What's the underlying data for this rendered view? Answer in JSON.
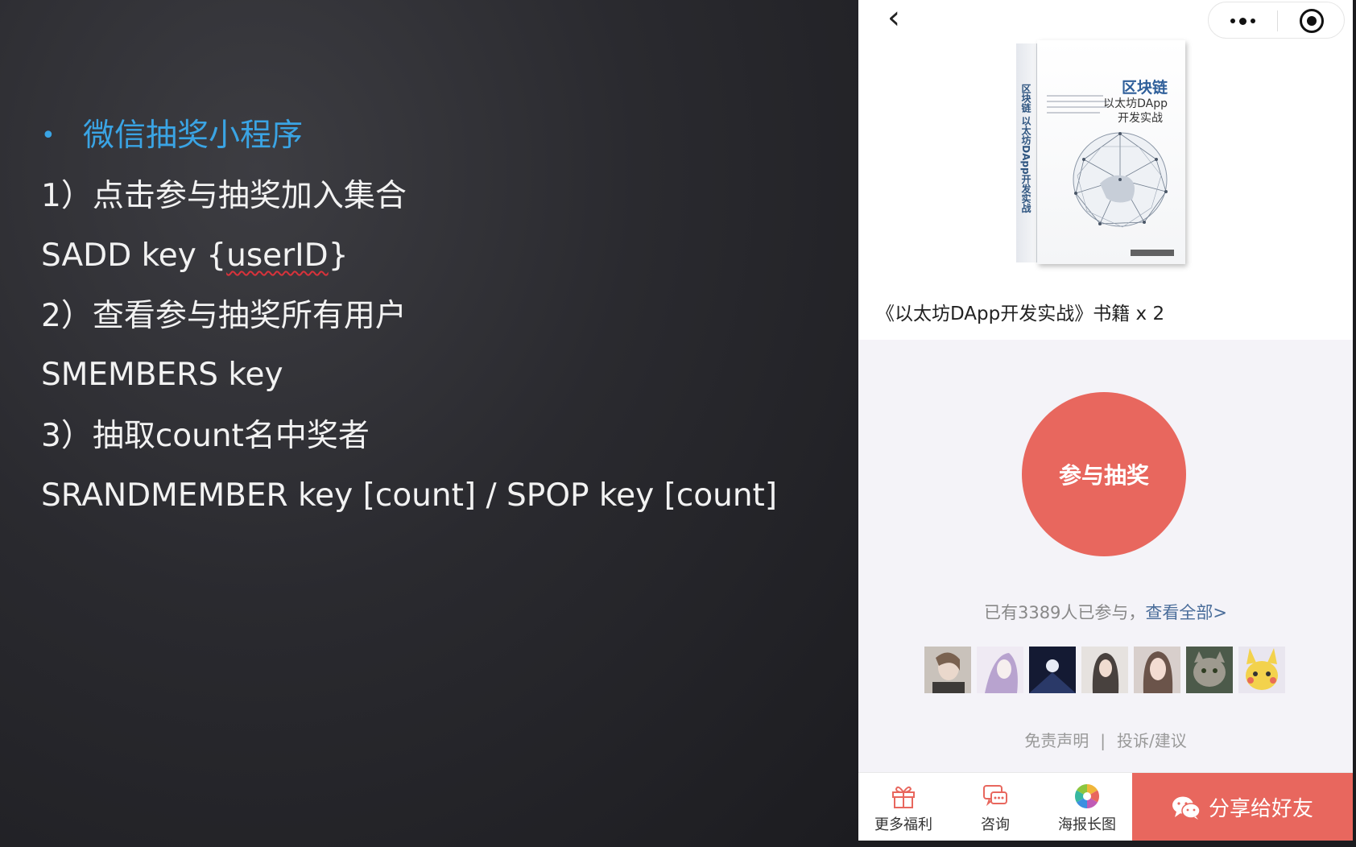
{
  "slide": {
    "heading": "微信抽奖小程序",
    "bullet": "•",
    "line1": "1）点击参与抽奖加入集合",
    "line2_prefix": "SADD key {",
    "line2_var": "userID",
    "line2_suffix": "}",
    "line3": "2）查看参与抽奖所有用户",
    "line4": "SMEMBERS key",
    "line5": "3）抽取count名中奖者",
    "line6": "SRANDMEMBER key [count] / SPOP key [count]",
    "heading_color": "#3aa4e4"
  },
  "phone": {
    "back_icon": "‹",
    "book": {
      "spine_title": "区块链 以太坊DApp开发实战",
      "title": "区块链",
      "subtitle": "以太坊DApp",
      "subtitle2": "开发实战"
    },
    "prize": "《以太坊DApp开发实战》书籍 x 2",
    "join_label": "参与抽奖",
    "participants_prefix": "已有3389人已参与，",
    "participants_link": "查看全部>",
    "links": {
      "disclaimer": "免责声明",
      "separator": "|",
      "feedback": "投诉/建议"
    },
    "tabs": [
      {
        "label": "更多福利",
        "icon": "gift-icon"
      },
      {
        "label": "咨询",
        "icon": "chat-icon"
      },
      {
        "label": "海报长图",
        "icon": "photo-icon"
      }
    ],
    "share_label": "分享给好友",
    "accent_color": "#e8675e"
  }
}
